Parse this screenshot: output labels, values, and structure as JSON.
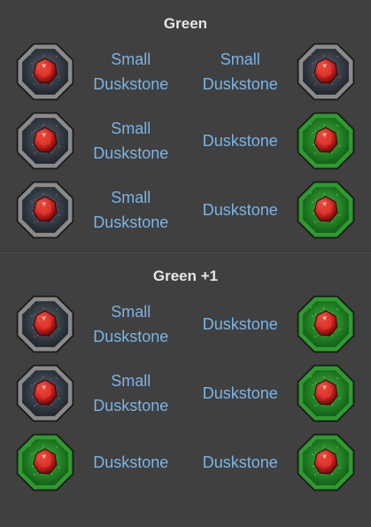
{
  "sections": [
    {
      "title": "Green",
      "rows": [
        {
          "left_icon": "gray-duskstone-icon",
          "left_label": [
            "Small",
            "Duskstone"
          ],
          "right_label": [
            "Small",
            "Duskstone"
          ],
          "right_icon": "gray-duskstone-icon"
        },
        {
          "left_icon": "gray-duskstone-icon",
          "left_label": [
            "Small",
            "Duskstone"
          ],
          "right_label": [
            "Duskstone"
          ],
          "right_icon": "green-duskstone-icon"
        },
        {
          "left_icon": "gray-duskstone-icon",
          "left_label": [
            "Small",
            "Duskstone"
          ],
          "right_label": [
            "Duskstone"
          ],
          "right_icon": "green-duskstone-icon"
        }
      ]
    },
    {
      "title": "Green +1",
      "rows": [
        {
          "left_icon": "gray-duskstone-icon",
          "left_label": [
            "Small",
            "Duskstone"
          ],
          "right_label": [
            "Duskstone"
          ],
          "right_icon": "green-duskstone-icon"
        },
        {
          "left_icon": "gray-duskstone-icon",
          "left_label": [
            "Small",
            "Duskstone"
          ],
          "right_label": [
            "Duskstone"
          ],
          "right_icon": "green-duskstone-icon"
        },
        {
          "left_icon": "green-duskstone-icon",
          "left_label": [
            "Duskstone"
          ],
          "right_label": [
            "Duskstone"
          ],
          "right_icon": "green-duskstone-icon"
        }
      ]
    }
  ],
  "colors": {
    "background": "#404040",
    "label": "#7ab4e8",
    "title": "#e6e6e6",
    "gray_frame": "#8a8a8a",
    "green_frame": "#2f9a2f",
    "gem": "#c41f1f"
  }
}
